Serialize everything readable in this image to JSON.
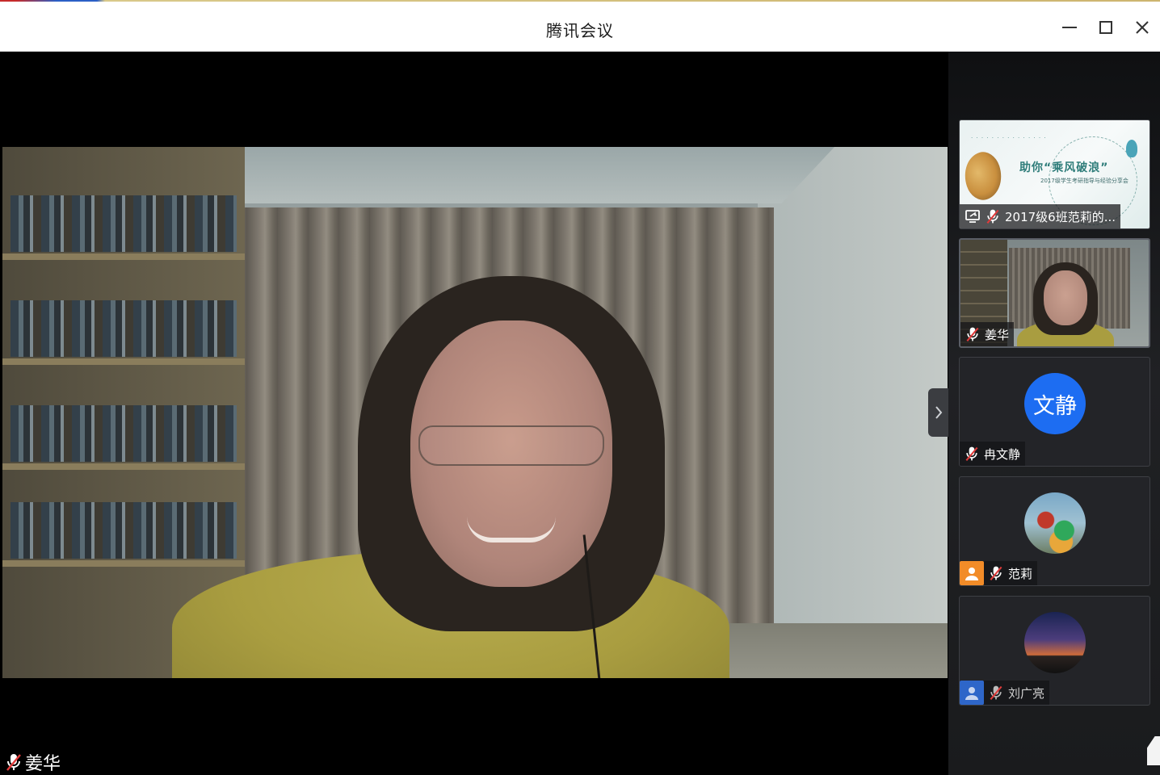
{
  "window": {
    "title": "腾讯会议",
    "controls": {
      "minimize_icon": "minimize-icon",
      "maximize_icon": "maximize-icon",
      "close_icon": "close-icon"
    }
  },
  "main_video": {
    "speaker_name": "姜华",
    "mic_status": "muted"
  },
  "sidebar": {
    "collapse_icon": "chevron-right-icon",
    "participants": [
      {
        "type": "screen-share",
        "label": "2017级6班范莉的...",
        "mic_status": "muted",
        "slide": {
          "heading": "助你“乘风破浪”",
          "subtitle": "2017级学生考研指导与经验分享会"
        }
      },
      {
        "type": "video",
        "label": "姜华",
        "mic_status": "muted"
      },
      {
        "type": "avatar-text",
        "avatar_text": "文静",
        "label": "冉文静",
        "mic_status": "muted",
        "avatar_color": "#1d6df2"
      },
      {
        "type": "avatar-image",
        "label": "范莉",
        "mic_status": "muted",
        "badge_color": "#f28c28"
      },
      {
        "type": "avatar-image",
        "label": "刘广亮",
        "mic_status": "muted",
        "badge_color": "#2e66c9"
      }
    ]
  },
  "colors": {
    "titlebar_bg": "#ffffff",
    "main_bg": "#000000",
    "sidebar_bg": "#1a1b1d",
    "mic_muted": "#e03b3b",
    "avatar_blue": "#1d6df2"
  }
}
